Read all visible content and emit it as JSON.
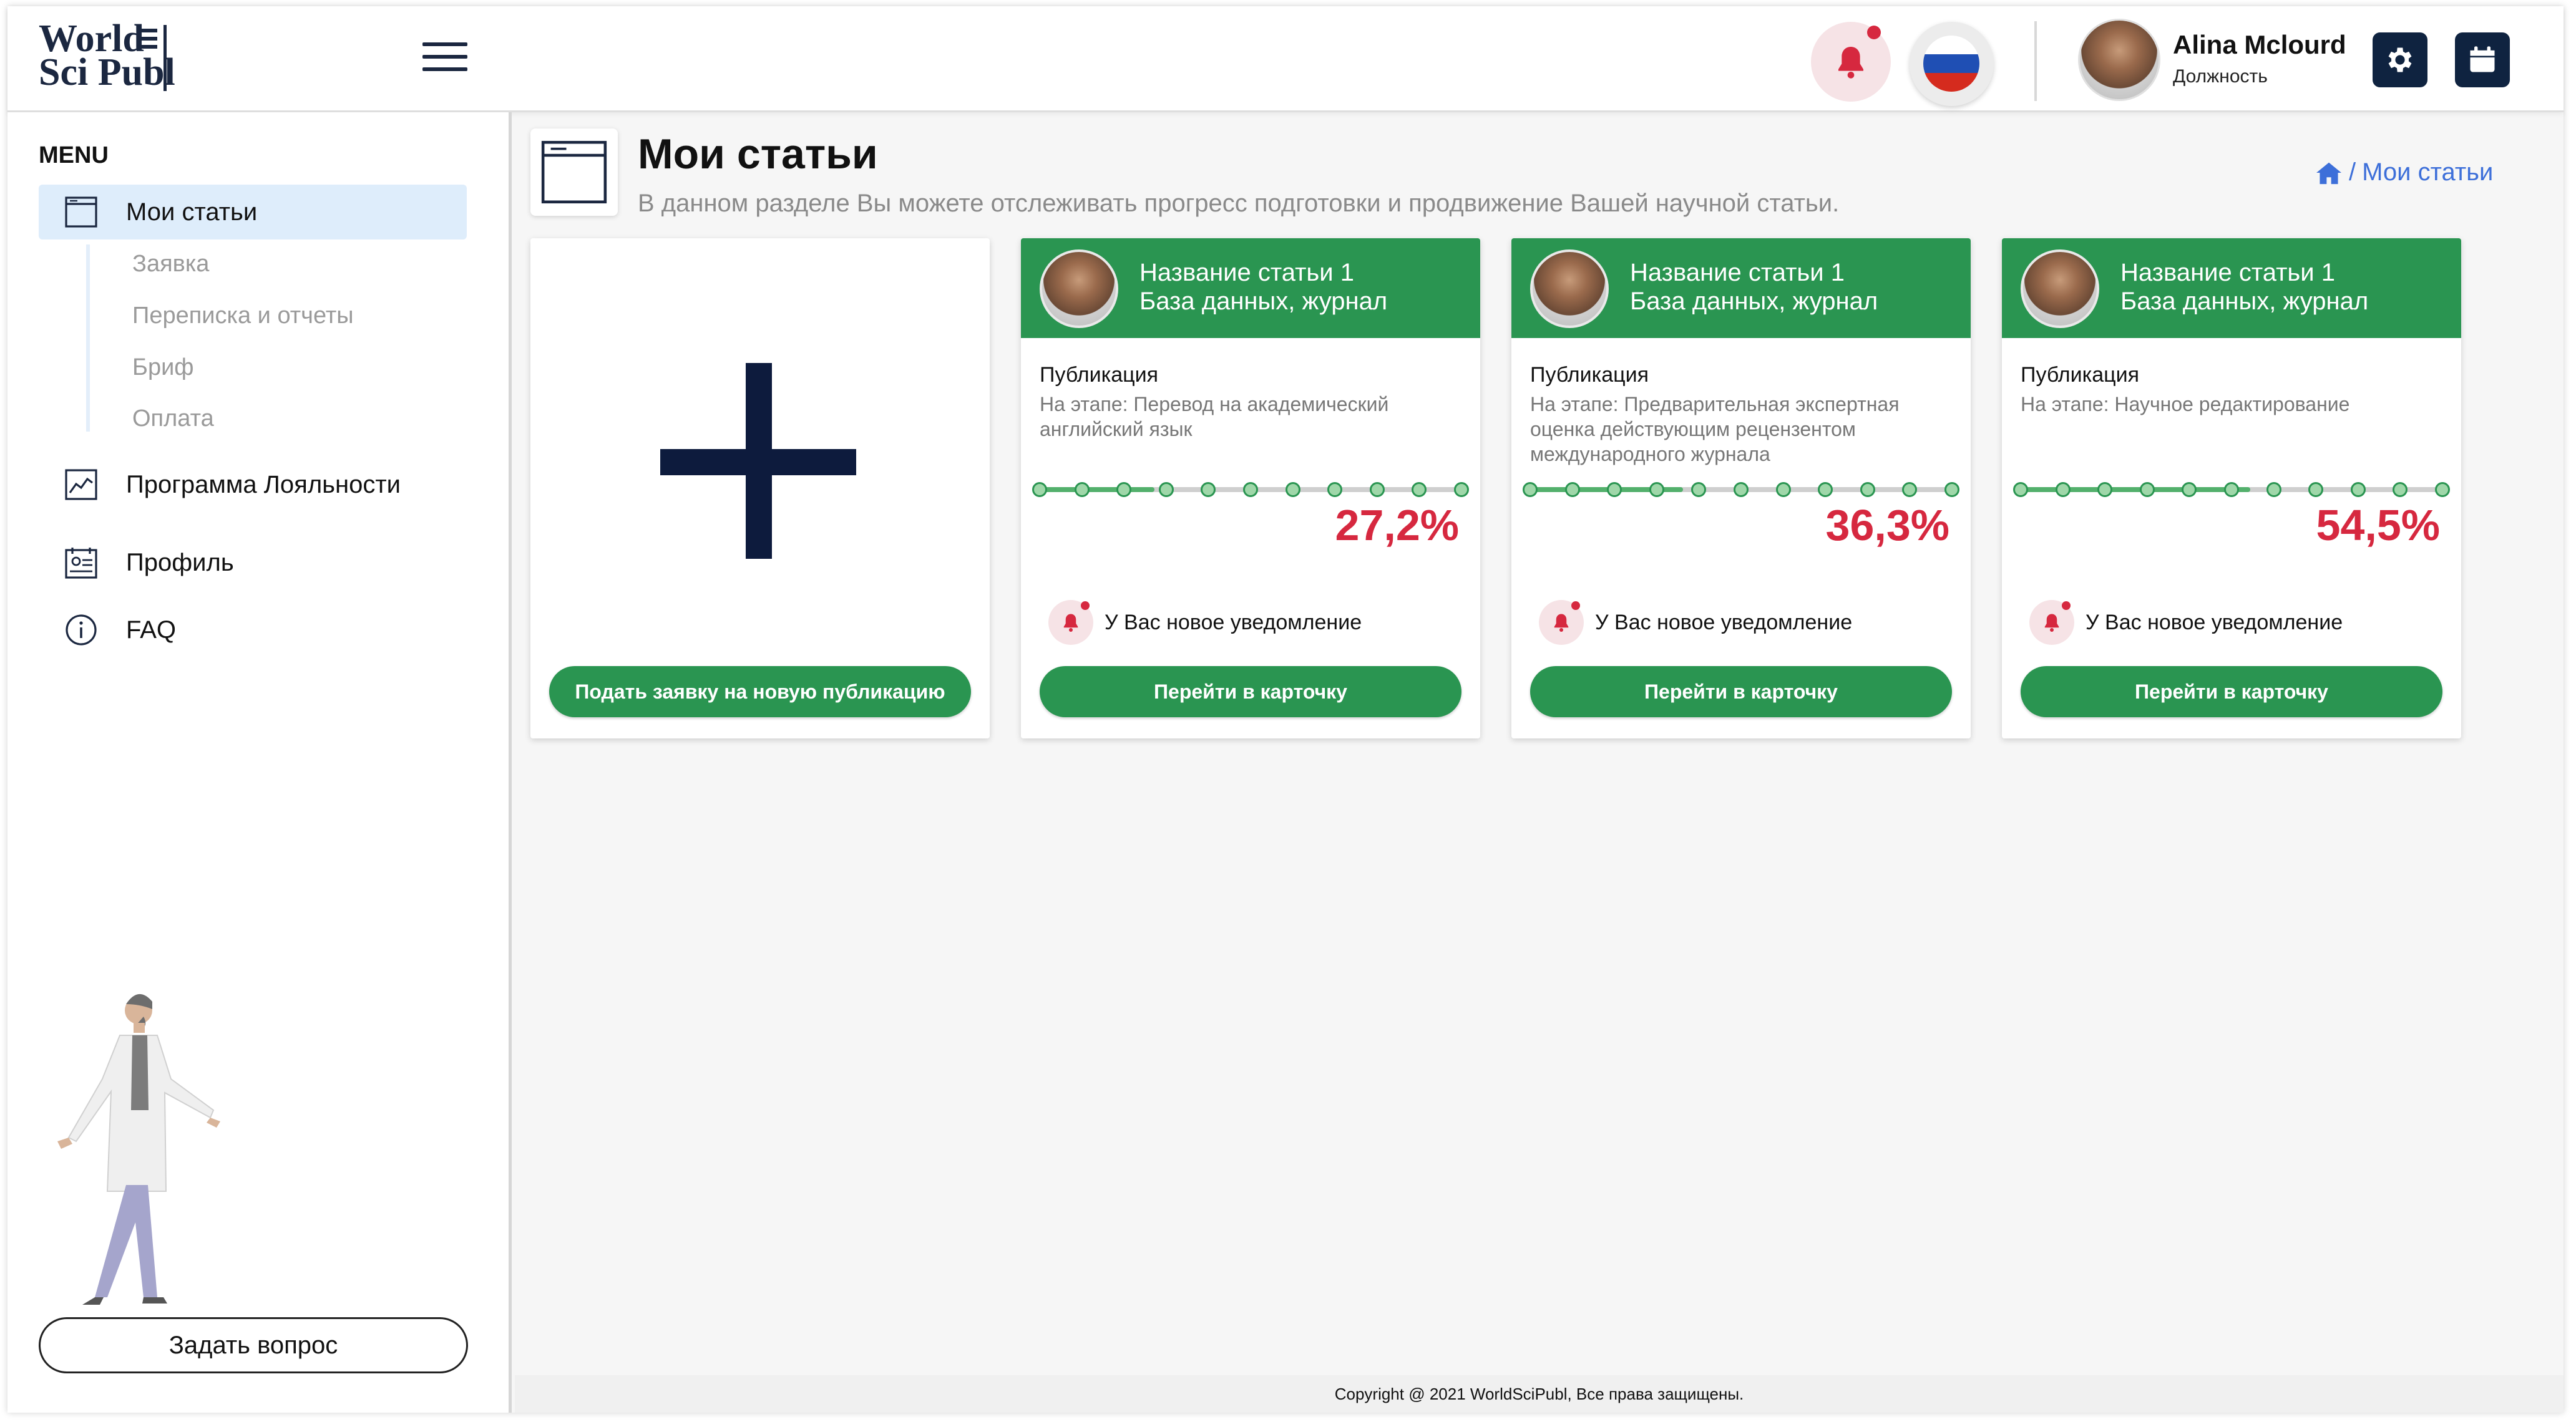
{
  "logo": {
    "line1": "World",
    "line2": "Sci Publ"
  },
  "header": {
    "user_name": "Alina Mclourd",
    "user_role": "Должность"
  },
  "sidebar": {
    "menu_title": "MENU",
    "items": [
      {
        "label": "Мои статьи",
        "icon": "browser-window-icon",
        "active": true
      },
      {
        "label": "Программа Лояльности",
        "icon": "line-chart-icon"
      },
      {
        "label": "Профиль",
        "icon": "id-card-icon"
      },
      {
        "label": "FAQ",
        "icon": "info-circle-icon"
      }
    ],
    "subitems": [
      "Заявка",
      "Переписка и отчеты",
      "Бриф",
      "Оплата"
    ],
    "ask_button": "Задать вопрос"
  },
  "page": {
    "title": "Мои статьи",
    "description": "В данном разделе Вы можете отслеживать прогресс подготовки и продвижение Вашей научной статьи.",
    "breadcrumb_sep": "/",
    "breadcrumb_current": "Мои статьи"
  },
  "add_card": {
    "button": "Подать заявку на новую публикацию"
  },
  "articles": [
    {
      "title": "Название статьи 1",
      "subtitle": "База данных, журнал",
      "pub_label": "Публикация",
      "stage": "На этапе: Перевод на академический английский язык",
      "progress": 0.272,
      "percent": "27,2%",
      "notification": "У Вас новое уведомление",
      "button": "Перейти в карточку"
    },
    {
      "title": "Название статьи 1",
      "subtitle": "База данных, журнал",
      "pub_label": "Публикация",
      "stage": "На этапе: Предварительная экспертная оценка действующим рецензентом международного журнала",
      "progress": 0.363,
      "percent": "36,3%",
      "notification": "У Вас новое уведомление",
      "button": "Перейти в карточку"
    },
    {
      "title": "Название статьи 1",
      "subtitle": "База данных, журнал",
      "pub_label": "Публикация",
      "stage": "На этапе: Научное редактирование",
      "progress": 0.545,
      "percent": "54,5%",
      "notification": "У Вас новое уведомление",
      "button": "Перейти в карточку"
    }
  ],
  "footer": {
    "copyright": "Copyright @ 2021 WorldSciPubl, Все права защищены."
  },
  "colors": {
    "accent_green": "#2a9551",
    "percent_red": "#d6283f",
    "navy": "#0f2340",
    "link_blue": "#3d6fd9"
  }
}
